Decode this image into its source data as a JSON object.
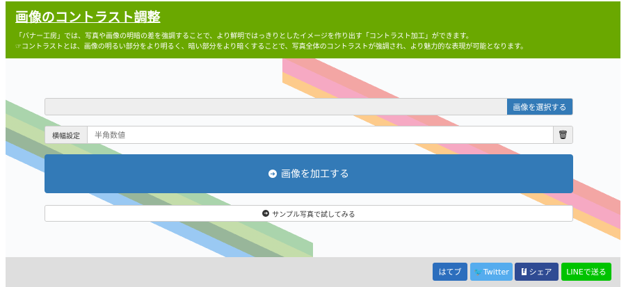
{
  "header": {
    "title": "画像のコントラスト調整",
    "line1": "「バナー工房」では、写真や画像の明暗の差を強調することで、より鮮明ではっきりとしたイメージを作り出す「コントラスト加工」ができます。",
    "line2": "コントラストとは、画像の明るい部分をより明るく、暗い部分をより暗くすることで、写真全体のコントラストが強調され、より魅力的な表現が可能となります。"
  },
  "form": {
    "select_image_label": "画像を選択する",
    "width_label": "横幅設定",
    "width_placeholder": "半角数値",
    "width_value": "",
    "process_label": "画像を加工する",
    "sample_label": "サンプル写真で試してみる"
  },
  "share": {
    "hatena": "はてブ",
    "twitter": "Twitter",
    "facebook": "シェア",
    "line": "LINEで送る"
  },
  "colors": {
    "header": "#6aa800",
    "primary": "#337ab7",
    "hatena": "#2c6ebd",
    "twitter": "#55acee",
    "facebook": "#2f4b93",
    "line": "#00c300"
  }
}
